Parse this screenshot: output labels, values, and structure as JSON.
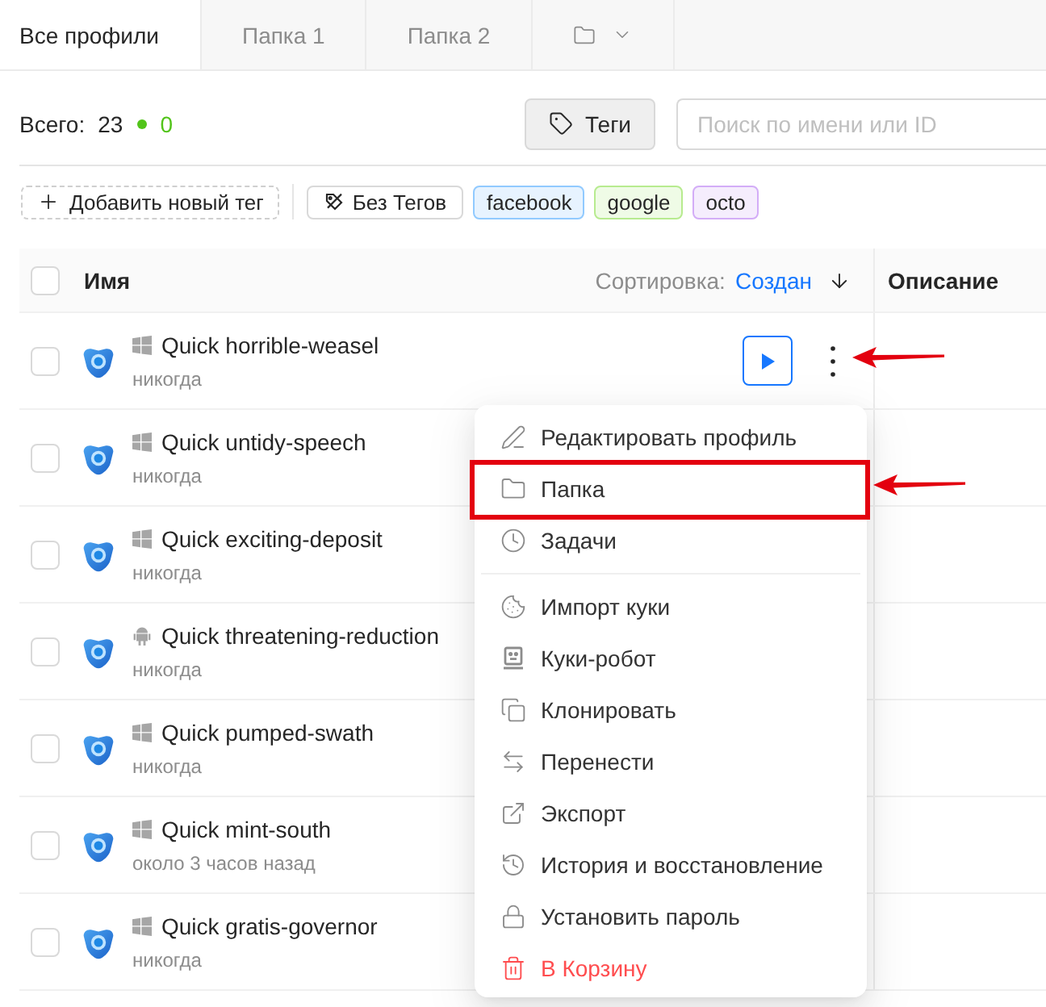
{
  "tabs": [
    {
      "kind": "text",
      "label": "Все профили",
      "selected": true
    },
    {
      "kind": "text",
      "label": "Папка 1",
      "selected": false
    },
    {
      "kind": "text",
      "label": "Папка 2",
      "selected": false
    },
    {
      "kind": "folder-menu",
      "selected": false
    }
  ],
  "toolbar": {
    "total_label": "Всего:",
    "total": "23",
    "running": "0",
    "tags_button": "Теги",
    "search": {
      "placeholder": "Поиск по имени или ID"
    }
  },
  "tag_bar": {
    "add_button": "Добавить новый тег",
    "tags": [
      {
        "kind": "untagged",
        "label": "Без Тегов"
      },
      {
        "kind": "tag",
        "label": "facebook",
        "color": "#91caff"
      },
      {
        "kind": "tag",
        "label": "google",
        "color": "#b7eb8f"
      },
      {
        "kind": "tag",
        "label": "octo",
        "color": "#d3adf7"
      }
    ]
  },
  "table": {
    "header": {
      "checked": false,
      "name": "Имя",
      "sort_label": "Сортировка:",
      "sort_value": "Создан",
      "description": "Описание"
    },
    "rows": [
      {
        "kind": "windows",
        "name": "Quick horrible-weasel",
        "last_run": "никогда",
        "checked": false,
        "menu_open": true,
        "marked": true
      },
      {
        "kind": "windows",
        "name": "Quick untidy-speech",
        "last_run": "никогда",
        "checked": false,
        "menu_open": false,
        "marked": false
      },
      {
        "kind": "windows",
        "name": "Quick exciting-deposit",
        "last_run": "никогда",
        "checked": false,
        "menu_open": false,
        "marked": false
      },
      {
        "kind": "android",
        "name": "Quick threatening-reduction",
        "last_run": "никогда",
        "checked": false,
        "menu_open": false,
        "marked": false
      },
      {
        "kind": "windows",
        "name": "Quick pumped-swath",
        "last_run": "никогда",
        "checked": false,
        "menu_open": false,
        "marked": false
      },
      {
        "kind": "windows",
        "name": "Quick mint-south",
        "last_run": "около 3 часов назад",
        "checked": false,
        "menu_open": false,
        "marked": false
      },
      {
        "kind": "windows",
        "name": "Quick gratis-governor",
        "last_run": "никогда",
        "checked": false,
        "menu_open": false,
        "marked": false
      }
    ]
  },
  "context_menu": {
    "groups": [
      {
        "items": [
          {
            "label": "Редактировать профиль",
            "danger": false,
            "marked": false
          },
          {
            "label": "Папка",
            "danger": false,
            "marked": true
          },
          {
            "label": "Задачи",
            "danger": false,
            "marked": false
          }
        ]
      },
      {
        "items": [
          {
            "label": "Импорт куки",
            "danger": false,
            "marked": false
          },
          {
            "label": "Куки-робот",
            "danger": false,
            "marked": false
          },
          {
            "label": "Клонировать",
            "danger": false,
            "marked": false
          },
          {
            "label": "Перенести",
            "danger": false,
            "marked": false
          },
          {
            "label": "Экспорт",
            "danger": false,
            "marked": false
          },
          {
            "label": "История и восстановление",
            "danger": false,
            "marked": false
          },
          {
            "label": "Установить пароль",
            "danger": false,
            "marked": false
          },
          {
            "label": "В Корзину",
            "danger": true,
            "marked": false
          }
        ]
      }
    ]
  }
}
